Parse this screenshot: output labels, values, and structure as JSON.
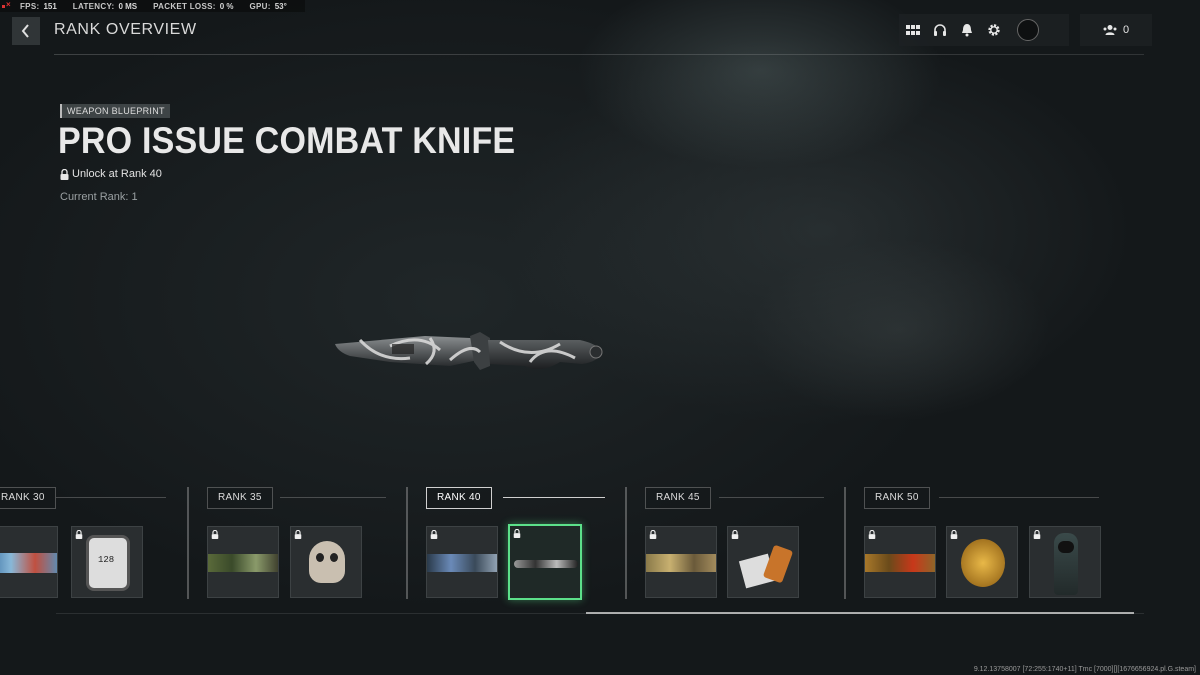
{
  "perf": {
    "fps_label": "FPS:",
    "fps": "151",
    "latency_label": "LATENCY:",
    "latency": "0 MS",
    "packet_label": "PACKET LOSS:",
    "packet": "0 %",
    "gpu_label": "GPU:",
    "gpu": "53°"
  },
  "header": {
    "title": "RANK OVERVIEW",
    "icons": [
      "grid-icon",
      "headset-icon",
      "bell-icon",
      "gear-icon"
    ],
    "friends_count": "0"
  },
  "item": {
    "tag": "WEAPON BLUEPRINT",
    "name": "PRO ISSUE COMBAT KNIFE",
    "unlock": "Unlock at Rank 40",
    "current_rank": "Current Rank: 1"
  },
  "ranks": [
    {
      "label": "RANK 30"
    },
    {
      "label": "RANK 35"
    },
    {
      "label": "RANK 40",
      "selected": true
    },
    {
      "label": "RANK 45"
    },
    {
      "label": "RANK 50"
    }
  ],
  "scroll": {
    "position": 0.5
  },
  "footer": "9.12.13758007 [72:255:1740+11] Tmc [7000][][1676656924.pl.G.steam]",
  "colors": {
    "selected_border": "#5ce08a",
    "background": "#14181a"
  }
}
